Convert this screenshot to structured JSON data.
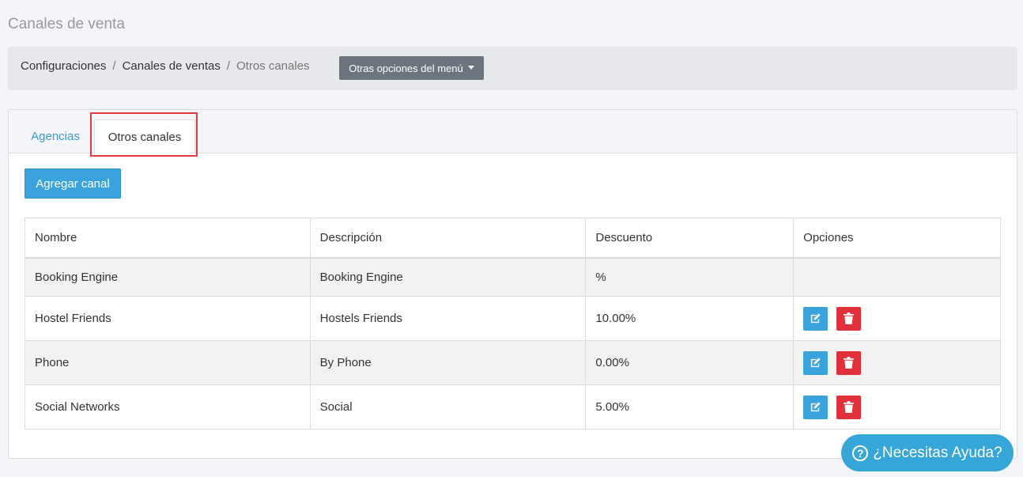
{
  "page": {
    "title": "Canales de venta"
  },
  "breadcrumb": {
    "items": [
      "Configuraciones",
      "Canales de ventas",
      "Otros canales"
    ],
    "separator": "/",
    "menu_button": "Otras opciones del menú"
  },
  "tabs": [
    {
      "label": "Agencias",
      "active": false
    },
    {
      "label": "Otros canales",
      "active": true
    }
  ],
  "add_button": "Agregar canal",
  "table": {
    "headers": [
      "Nombre",
      "Descripción",
      "Descuento",
      "Opciones"
    ],
    "rows": [
      {
        "nombre": "Booking Engine",
        "descripcion": "Booking Engine",
        "descuento": "%",
        "has_actions": false
      },
      {
        "nombre": "Hostel Friends",
        "descripcion": "Hostels Friends",
        "descuento": "10.00%",
        "has_actions": true
      },
      {
        "nombre": "Phone",
        "descripcion": "By Phone",
        "descuento": "0.00%",
        "has_actions": true
      },
      {
        "nombre": "Social Networks",
        "descripcion": "Social",
        "descuento": "5.00%",
        "has_actions": true
      }
    ]
  },
  "icons": {
    "edit": "edit-icon",
    "delete": "trash-icon",
    "help": "question-circle-icon",
    "dropdown": "caret-down-icon"
  },
  "colors": {
    "primary": "#3aa3dd",
    "danger": "#e0303a",
    "secondary": "#6c757d",
    "highlight": "#e0393e"
  },
  "help": {
    "q": "?",
    "label": "¿Necesitas Ayuda?"
  }
}
